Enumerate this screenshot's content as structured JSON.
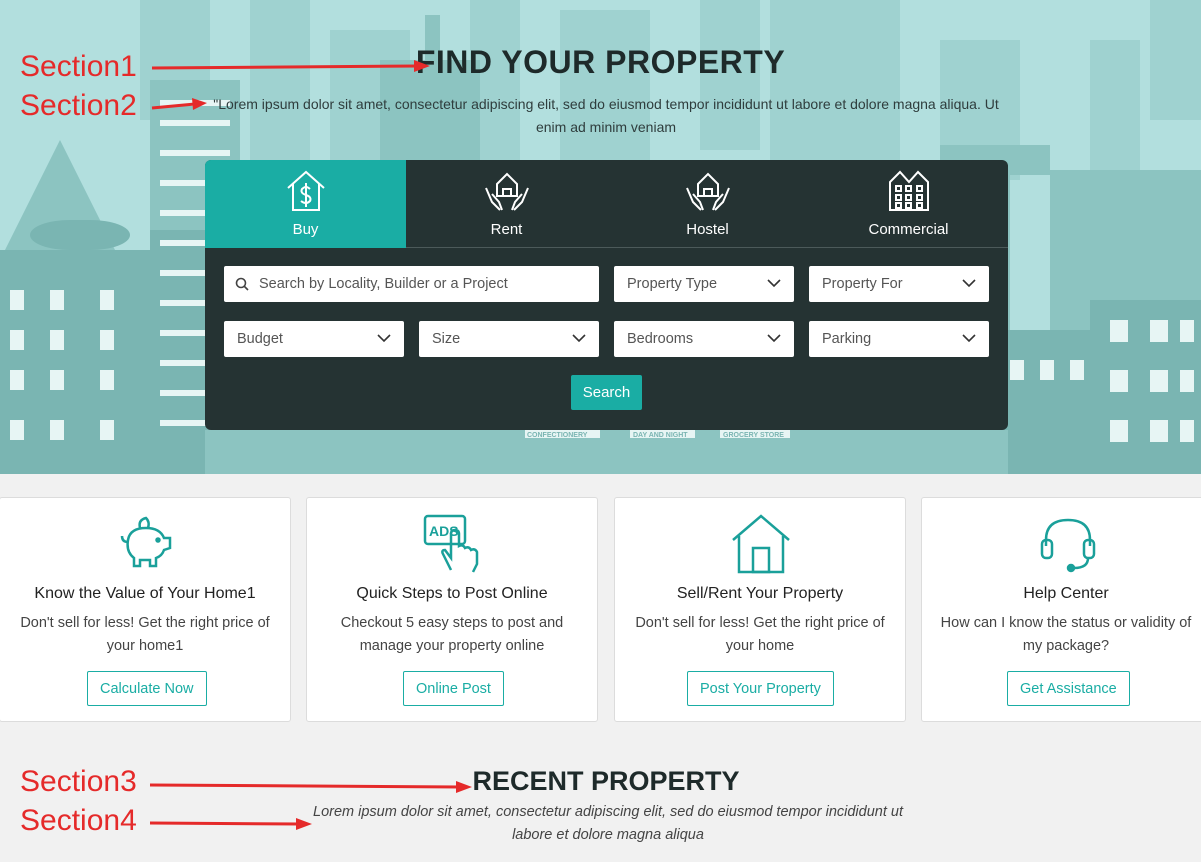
{
  "hero": {
    "title": "FIND YOUR PROPERTY",
    "subtitle": "\"Lorem ipsum dolor sit amet, consectetur adipiscing elit, sed do eiusmod tempor incididunt ut labore et dolore magna aliqua. Ut enim ad minim veniam"
  },
  "tabs": [
    {
      "label": "Buy",
      "icon": "house-dollar-icon",
      "active": true
    },
    {
      "label": "Rent",
      "icon": "hands-house-icon",
      "active": false
    },
    {
      "label": "Hostel",
      "icon": "hands-house-icon",
      "active": false
    },
    {
      "label": "Commercial",
      "icon": "building-icon",
      "active": false
    }
  ],
  "search": {
    "placeholder": "Search by Locality, Builder or a Project",
    "property_type": "Property Type",
    "property_for": "Property For",
    "budget": "Budget",
    "size": "Size",
    "bedrooms": "Bedrooms",
    "parking": "Parking",
    "button": "Search"
  },
  "cards": [
    {
      "icon": "piggy-bank-icon",
      "title": "Know the Value of Your Home1",
      "desc": "Don't sell for less! Get the right price of your home1",
      "button": "Calculate Now"
    },
    {
      "icon": "ads-click-icon",
      "title": "Quick Steps to Post Online",
      "desc": "Checkout 5 easy steps to post and manage your property online",
      "button": "Online Post"
    },
    {
      "icon": "home-icon",
      "title": "Sell/Rent Your Property",
      "desc": "Don't sell for less! Get the right price of your home",
      "button": "Post Your Property"
    },
    {
      "icon": "headset-icon",
      "title": "Help Center",
      "desc": "How can I know the status or validity of my package?",
      "button": "Get Assistance"
    }
  ],
  "recent": {
    "title": "RECENT PROPERTY",
    "subtitle": "Lorem ipsum dolor sit amet, consectetur adipiscing elit, sed do eiusmod tempor incididunt ut labore et dolore magna aliqua"
  },
  "annotations": {
    "s1": "Section1",
    "s2": "Section2",
    "s3": "Section3",
    "s4": "Section4"
  },
  "signs": {
    "confectionery": "CONFECTIONERY",
    "day_night": "DAY AND NIGHT",
    "grocery": "GROCERY STORE"
  },
  "colors": {
    "accent": "#1aada4",
    "hero_bg": "#b2dfde",
    "panel_bg": "#253333",
    "annotation": "#e52a2a"
  }
}
